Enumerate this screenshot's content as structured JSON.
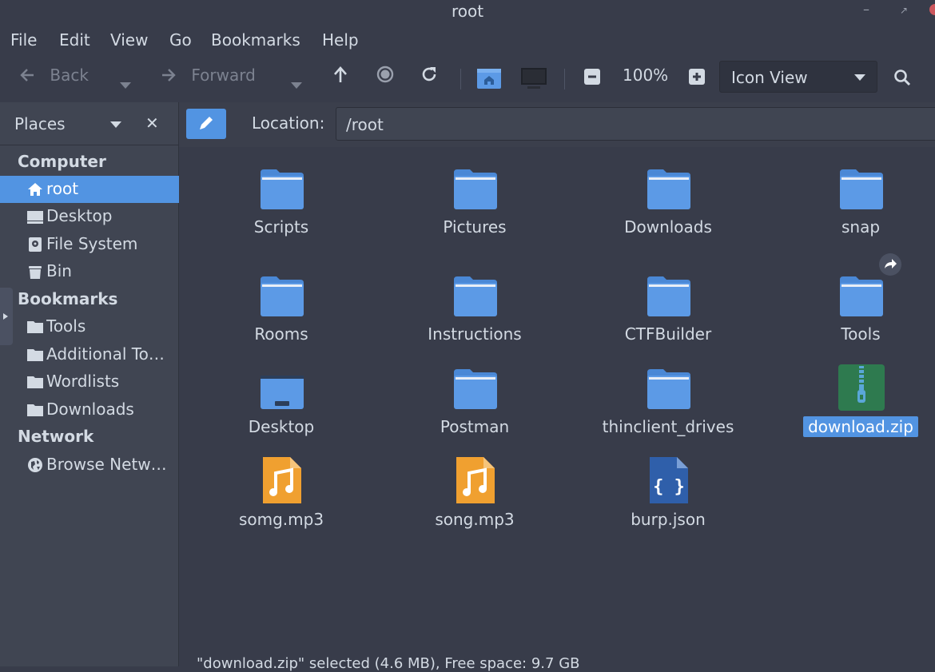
{
  "window": {
    "title": "root"
  },
  "menu": {
    "items": [
      "File",
      "Edit",
      "View",
      "Go",
      "Bookmarks",
      "Help"
    ]
  },
  "toolbar": {
    "back_label": "Back",
    "forward_label": "Forward",
    "zoom_level": "100%",
    "view_mode": "Icon View"
  },
  "sidebar": {
    "header_label": "Places",
    "sections": {
      "computer": "Computer",
      "bookmarks": "Bookmarks",
      "network": "Network"
    },
    "computer_items": [
      "root",
      "Desktop",
      "File System",
      "Bin"
    ],
    "bookmark_items": [
      "Tools",
      "Additional To…",
      "Wordlists",
      "Downloads"
    ],
    "network_items": [
      "Browse Netw…"
    ]
  },
  "location": {
    "label": "Location:",
    "value": "/root"
  },
  "files": [
    {
      "name": "Scripts",
      "type": "folder"
    },
    {
      "name": "Pictures",
      "type": "folder"
    },
    {
      "name": "Downloads",
      "type": "folder"
    },
    {
      "name": "snap",
      "type": "folder"
    },
    {
      "name": "Rooms",
      "type": "folder"
    },
    {
      "name": "Instructions",
      "type": "folder"
    },
    {
      "name": "CTFBuilder",
      "type": "folder"
    },
    {
      "name": "Tools",
      "type": "folder-link"
    },
    {
      "name": "Desktop",
      "type": "desktop-folder"
    },
    {
      "name": "Postman",
      "type": "folder"
    },
    {
      "name": "thinclient_drives",
      "type": "folder"
    },
    {
      "name": "download.zip",
      "type": "zip",
      "selected": true
    },
    {
      "name": "somg.mp3",
      "type": "audio"
    },
    {
      "name": "song.mp3",
      "type": "audio"
    },
    {
      "name": "burp.json",
      "type": "json"
    }
  ],
  "status": {
    "text": "\"download.zip\" selected (4.6 MB), Free space: 9.7 GB"
  },
  "colors": {
    "accent": "#5294e2",
    "folder": "#5c9ae6",
    "background": "#383c4a",
    "sidebar": "#404552"
  }
}
